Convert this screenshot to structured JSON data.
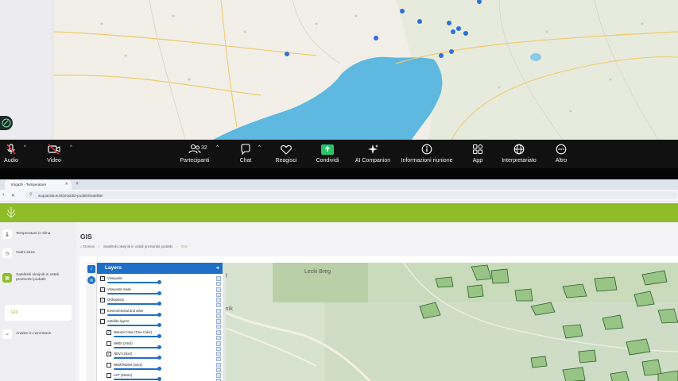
{
  "toolbar": {
    "audio": "Audio",
    "video": "Video",
    "participants": "Partecipanti",
    "participants_count": "32",
    "chat": "Chat",
    "react": "Reagisci",
    "share": "Condividi",
    "ai": "AI Companion",
    "info": "Informazioni riunione",
    "apps": "App",
    "interpreter": "Interpretariato",
    "more": "Altro"
  },
  "browser": {
    "tab_title": "Irrigazh - Temperature",
    "url": "acquacitta.eu/it/prodotti/-podatki/satellite/",
    "sidebar": [
      {
        "label": "Temperature in tilma"
      },
      {
        "label": "Vodni stres"
      },
      {
        "label": "Satelitski okvijnik in ostali prostorski podatki"
      },
      {
        "label": "Analize in razvrstave"
      }
    ],
    "sidebar_sub": "GIS",
    "page_title": "GIS",
    "breadcrumb": [
      "Domov",
      "Satelitski okvijnik in ostali prostorski podatki",
      "GIS"
    ],
    "map_labels": {
      "place1": "Lecki Breg",
      "place2": "of",
      "place3": "sník"
    },
    "layers": {
      "title": "Layers",
      "items": [
        {
          "label": "Vineyards",
          "checked": true,
          "level": 0
        },
        {
          "label": "Vineyards mask",
          "checked": true,
          "level": 0
        },
        {
          "label": "Orthophoto",
          "checked": true,
          "level": 0
        },
        {
          "label": "Environmental and other",
          "checked": true,
          "level": 0
        },
        {
          "label": "Satellite layers",
          "checked": false,
          "level": 0
        },
        {
          "label": "Natural Color (True Color)",
          "checked": true,
          "level": 1
        },
        {
          "label": "NMDI (24x2)",
          "checked": false,
          "level": 1
        },
        {
          "label": "NDVI (24x2)",
          "checked": true,
          "level": 1
        },
        {
          "label": "NDMI/NDWI (24x2)",
          "checked": false,
          "level": 1
        },
        {
          "label": "LST (29x24)",
          "checked": false,
          "level": 1
        }
      ]
    }
  },
  "colors": {
    "brand_green": "#8fbd2a",
    "layers_blue": "#1f6fc8",
    "share_green": "#27c46b",
    "sea_blue": "#5fb8e0"
  }
}
